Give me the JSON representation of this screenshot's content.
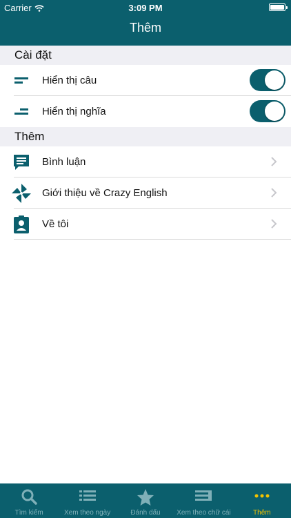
{
  "status": {
    "carrier": "Carrier",
    "time": "3:09 PM"
  },
  "nav": {
    "title": "Thêm"
  },
  "sections": {
    "settings": {
      "title": "Cài đặt",
      "items": [
        {
          "label": "Hiển thị câu",
          "icon": "align-left-icon",
          "toggle": true
        },
        {
          "label": "Hiển thị nghĩa",
          "icon": "align-right-icon",
          "toggle": true
        }
      ]
    },
    "more": {
      "title": "Thêm",
      "items": [
        {
          "label": "Bình luận",
          "icon": "comment-icon"
        },
        {
          "label": "Giới thiệu về Crazy English",
          "icon": "pinwheel-icon"
        },
        {
          "label": "Về tôi",
          "icon": "contact-card-icon"
        }
      ]
    }
  },
  "tabbar": [
    {
      "label": "Tìm kiếm",
      "icon": "search-icon",
      "active": false
    },
    {
      "label": "Xem theo ngày",
      "icon": "list-icon",
      "active": false
    },
    {
      "label": "Đánh dấu",
      "icon": "star-icon",
      "active": false
    },
    {
      "label": "Xem theo chữ cái",
      "icon": "text-list-icon",
      "active": false
    },
    {
      "label": "Thêm",
      "icon": "more-icon",
      "active": true
    }
  ],
  "colors": {
    "primary": "#0b5f6d",
    "active_tab": "#f2c200",
    "inactive_tab": "#7fb0b8",
    "section_bg": "#efeff4"
  }
}
